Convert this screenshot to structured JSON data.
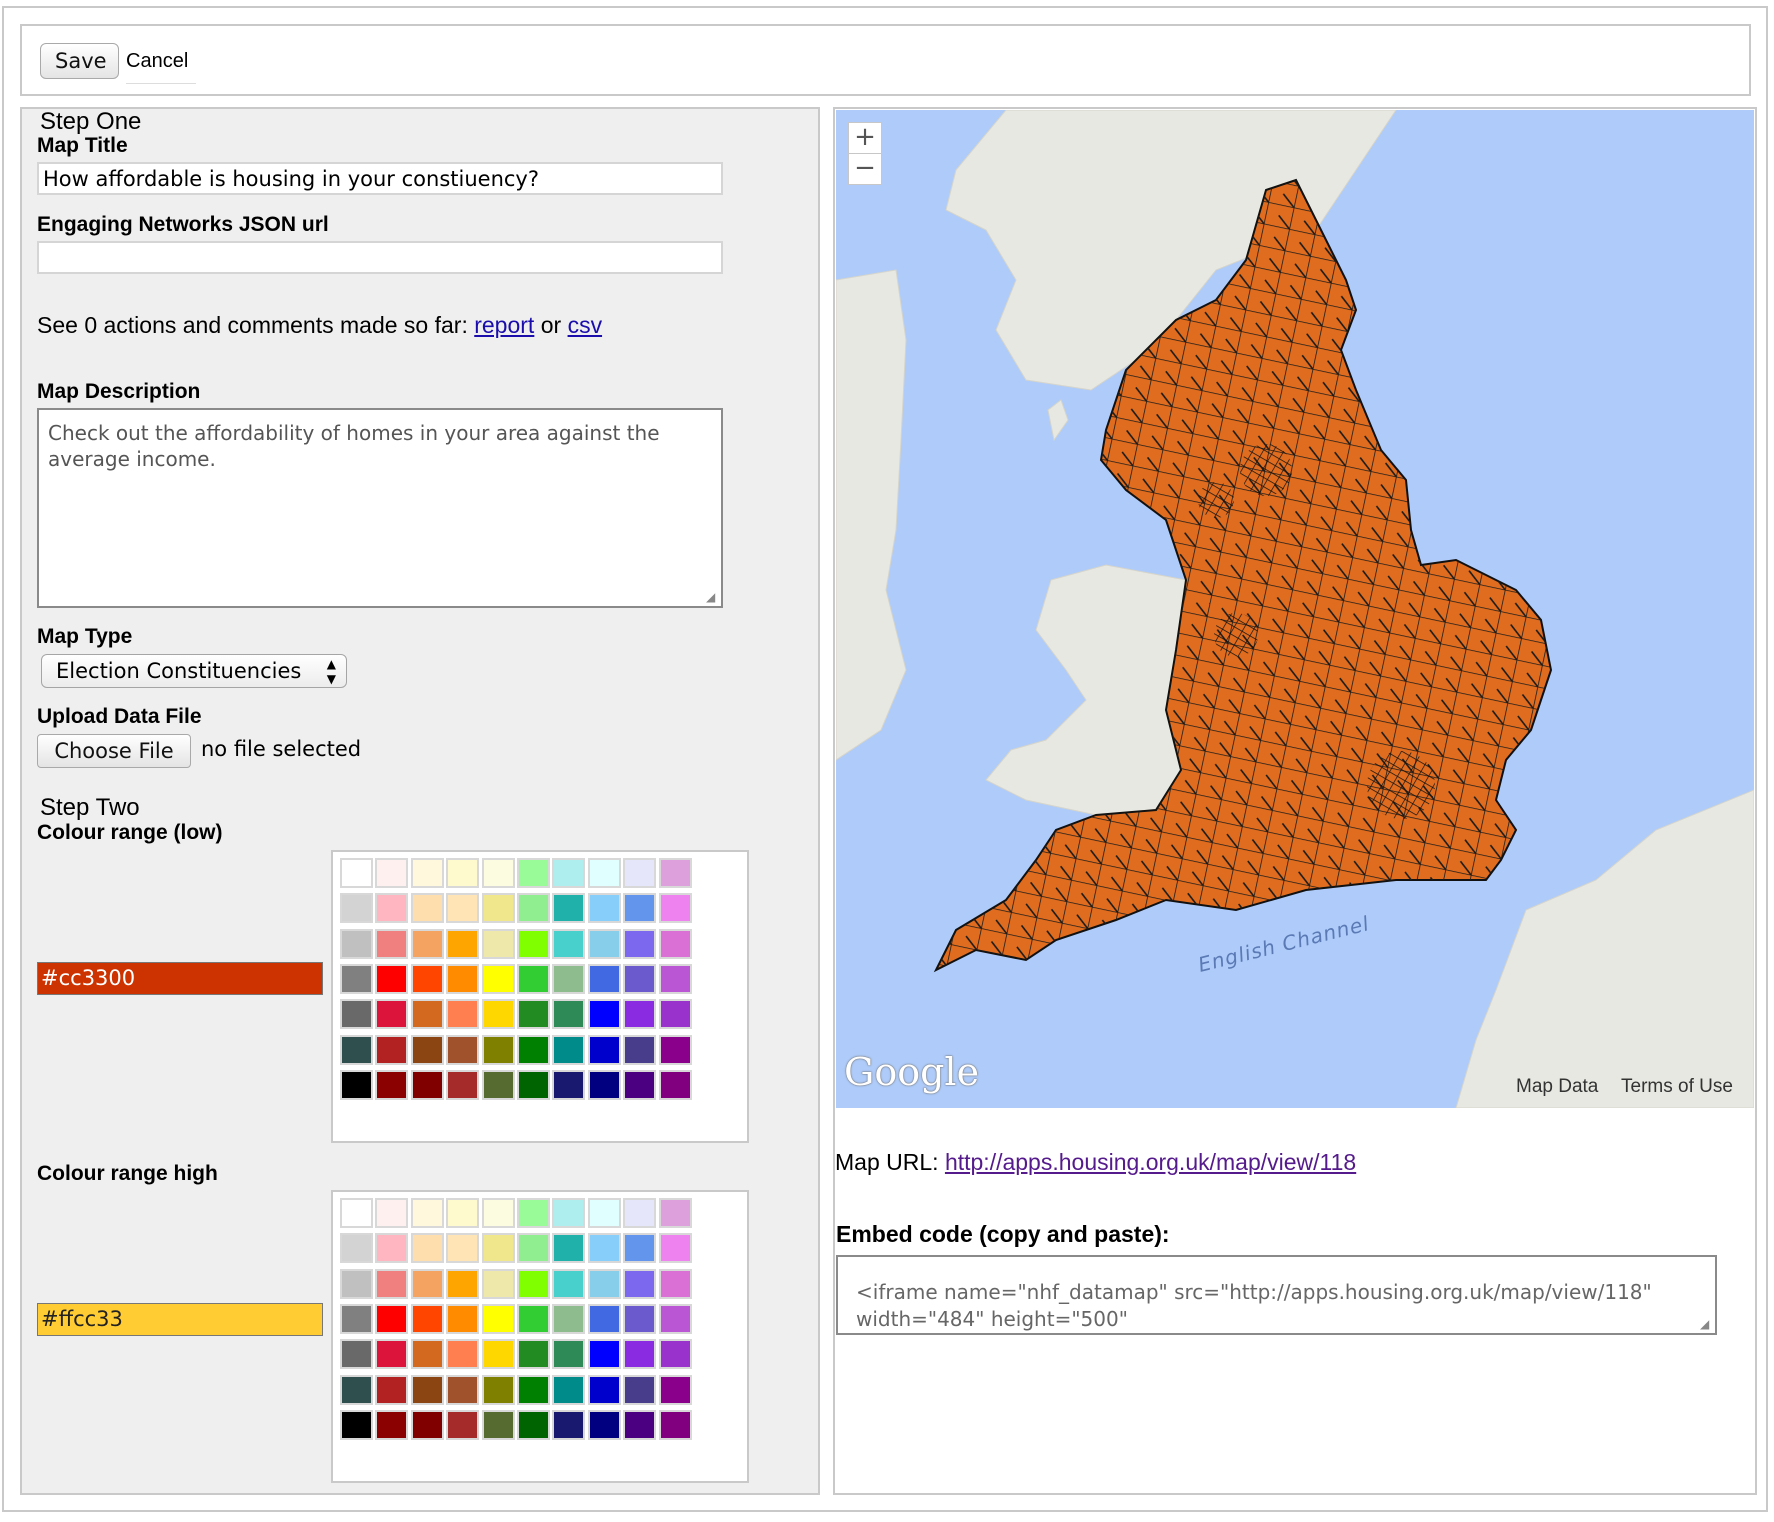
{
  "toolbar": {
    "save_label": "Save",
    "cancel_label": "Cancel"
  },
  "step_one": {
    "heading": "Step One",
    "map_title_label": "Map Title",
    "map_title_value": "How affordable is housing in your constiuency?",
    "json_url_label": "Engaging Networks JSON url",
    "json_url_value": "",
    "actions_text": "See 0 actions and comments made so far: ",
    "report_link": "report",
    "or_text": " or ",
    "csv_link": "csv",
    "description_label": "Map Description",
    "description_value": "Check out the affordability of homes in your area against the average income.",
    "map_type_label": "Map Type",
    "map_type_selected": "Election Constituencies",
    "upload_label": "Upload Data File",
    "choose_file_label": "Choose File",
    "file_status": "no file selected"
  },
  "step_two": {
    "heading": "Step Two",
    "low_label": "Colour range (low)",
    "low_value": "#cc3300",
    "low_color": "#cc3300",
    "high_label": "Colour range high",
    "high_value": "#ffcc33",
    "high_color": "#ffcc33"
  },
  "palette": [
    [
      "#ffffff",
      "#fff0f0",
      "#fff8dc",
      "#fffacd",
      "#fcfde0",
      "#98fb98",
      "#afeeee",
      "#e0ffff",
      "#e6e6fa",
      "#dda0dd"
    ],
    [
      "#d3d3d3",
      "#ffb6c1",
      "#ffdead",
      "#ffe4b5",
      "#f0e68c",
      "#90ee90",
      "#20b2aa",
      "#87cefa",
      "#6495ed",
      "#ee82ee"
    ],
    [
      "#c0c0c0",
      "#f08080",
      "#f4a460",
      "#ffa500",
      "#eee8aa",
      "#7fff00",
      "#48d1cc",
      "#87ceeb",
      "#7b68ee",
      "#da70d6"
    ],
    [
      "#808080",
      "#ff0000",
      "#ff4500",
      "#ff8c00",
      "#ffff00",
      "#32cd32",
      "#8fbc8f",
      "#4169e1",
      "#6a5acd",
      "#ba55d3"
    ],
    [
      "#696969",
      "#dc143c",
      "#d2691e",
      "#ff7f50",
      "#ffd700",
      "#228b22",
      "#2e8b57",
      "#0000ff",
      "#8a2be2",
      "#9932cc"
    ],
    [
      "#2f4f4f",
      "#b22222",
      "#8b4513",
      "#a0522d",
      "#808000",
      "#008000",
      "#008b8b",
      "#0000cd",
      "#483d8b",
      "#8b008b"
    ],
    [
      "#000000",
      "#8b0000",
      "#800000",
      "#a52a2a",
      "#556b2f",
      "#006400",
      "#191970",
      "#000080",
      "#4b0082",
      "#800080"
    ]
  ],
  "map": {
    "zoom_in": "+",
    "zoom_out": "−",
    "channel_label": "English Channel",
    "logo_text": "Google",
    "map_data_label": "Map Data",
    "terms_label": "Terms of Use",
    "sea_color": "#aecbf9",
    "land_color": "#e8e8e2",
    "fill_color": "#e06d1f"
  },
  "output": {
    "map_url_label": "Map URL: ",
    "map_url": "http://apps.housing.org.uk/map/view/118",
    "embed_label": "Embed code (copy and paste):",
    "embed_code": "<iframe name=\"nhf_datamap\" src=\"http://apps.housing.org.uk/map/view/118\" width=\"484\" height=\"500\""
  }
}
